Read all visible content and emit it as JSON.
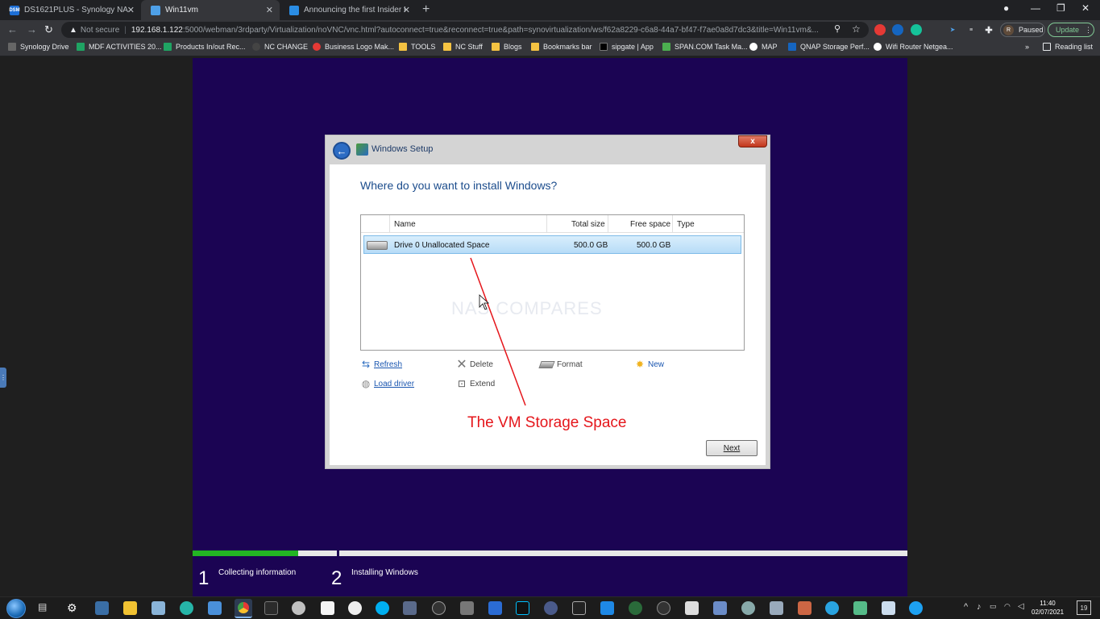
{
  "browser": {
    "tabs": [
      {
        "title": "DS1621PLUS - Synology NAS",
        "favicon_text": "DSM",
        "favicon_color": "#1d6fd6"
      },
      {
        "title": "Win11vm",
        "favicon_color": "#4ea0e8"
      },
      {
        "title": "Announcing the first Insider Pre",
        "favicon_color": "#2a8de4"
      }
    ],
    "address": {
      "warning": "Not secure",
      "host": "192.168.1.122",
      "path": ":5000/webman/3rdparty/Virtualization/noVNC/vnc.html?autoconnect=true&reconnect=true&path=synovirtualization/ws/f62a8229-c6a8-44a7-bf47-f7ae0a8d7dc3&title=Win11vm&..."
    },
    "profile_initial": "R",
    "profile_status": "Paused",
    "update_label": "Update",
    "bookmarks": [
      {
        "label": "Synology Drive",
        "icon_color": "#666666"
      },
      {
        "label": "MDF ACTIVITIES 20...",
        "icon_color": "#1fa463"
      },
      {
        "label": "Products In/out Rec...",
        "icon_color": "#1fa463"
      },
      {
        "label": "NC CHANGE",
        "icon_color": "#444444"
      },
      {
        "label": "Business Logo Mak...",
        "icon_color": "#e53935"
      },
      {
        "label": "TOOLS",
        "icon_color": "#f5c342"
      },
      {
        "label": "NC Stuff",
        "icon_color": "#f5c342"
      },
      {
        "label": "Blogs",
        "icon_color": "#f5c342"
      },
      {
        "label": "Bookmarks bar",
        "icon_color": "#f5c342"
      },
      {
        "label": "sipgate | App",
        "icon_color": "#000000"
      },
      {
        "label": "SPAN.COM Task Ma...",
        "icon_color": "#4caf50"
      },
      {
        "label": "MAP",
        "icon_color": "#ffffff"
      },
      {
        "label": "QNAP Storage Perf...",
        "icon_color": "#1565c0"
      },
      {
        "label": "Wifi Router Netgea...",
        "icon_color": "#ffffff"
      }
    ],
    "bookmarks_overflow": "»",
    "reading_list": "Reading list"
  },
  "setup": {
    "window_title": "Windows Setup",
    "close_glyph": "x",
    "question": "Where do you want to install Windows?",
    "columns": {
      "name": "Name",
      "total": "Total size",
      "free": "Free space",
      "type": "Type"
    },
    "drives": [
      {
        "name": "Drive 0 Unallocated Space",
        "total": "500.0 GB",
        "free": "500.0 GB",
        "type": ""
      }
    ],
    "watermark": "NAS COMPARES",
    "actions": {
      "refresh": "Refresh",
      "delete": "Delete",
      "format": "Format",
      "new": "New",
      "load_driver": "Load driver",
      "extend": "Extend"
    },
    "next_label": "Next"
  },
  "annotation": "The VM Storage Space",
  "steps": [
    {
      "number": "1",
      "label": "Collecting information"
    },
    {
      "number": "2",
      "label": "Installing Windows"
    }
  ],
  "progress": {
    "step1_fraction": 0.73
  },
  "taskbar": {
    "time": "11:40",
    "date": "02/07/2021",
    "notification_count": "19"
  }
}
